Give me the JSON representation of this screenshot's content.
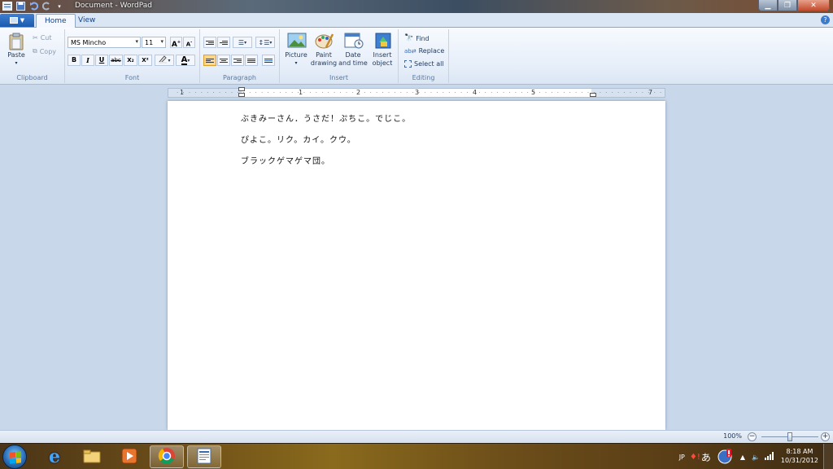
{
  "window": {
    "title": "Document - WordPad"
  },
  "tabs": [
    {
      "label": "Home",
      "active": true
    },
    {
      "label": "View",
      "active": false
    }
  ],
  "ribbon": {
    "clipboard": {
      "label": "Clipboard",
      "paste": "Paste",
      "cut": "Cut",
      "copy": "Copy"
    },
    "font": {
      "label": "Font",
      "family": "MS Mincho",
      "size": "11",
      "bold": "B",
      "italic": "I",
      "underline": "U",
      "strike": "abc",
      "subscript": "X₂",
      "superscript": "X²",
      "grow": "A",
      "shrink": "A"
    },
    "paragraph": {
      "label": "Paragraph"
    },
    "insert": {
      "label": "Insert",
      "picture": "Picture",
      "paint": "Paint drawing",
      "datetime": "Date and time",
      "object": "Insert object"
    },
    "editing": {
      "label": "Editing",
      "find": "Find",
      "replace": "Replace",
      "select_all": "Select all"
    }
  },
  "ruler": {
    "numbers": [
      "1",
      "1",
      "2",
      "3",
      "4",
      "5",
      "7"
    ]
  },
  "document": {
    "lines": [
      "ぶきみーさん．うさだ！ぷちこ。でじこ。",
      "ぴよこ。リク。カイ。クウ。",
      "ブラックゲマゲマ団。"
    ]
  },
  "status": {
    "zoom": "100%",
    "zoom_level": 100
  },
  "taskbar": {
    "lang": "JP",
    "ime": "あ",
    "time": "8:18 AM",
    "date": "10/31/2012"
  },
  "colors": {
    "accent": "#1b5aae",
    "ribbon_bg": "#e6eef9",
    "workspace": "#c8d7ea",
    "highlight": "#ffd68a"
  }
}
